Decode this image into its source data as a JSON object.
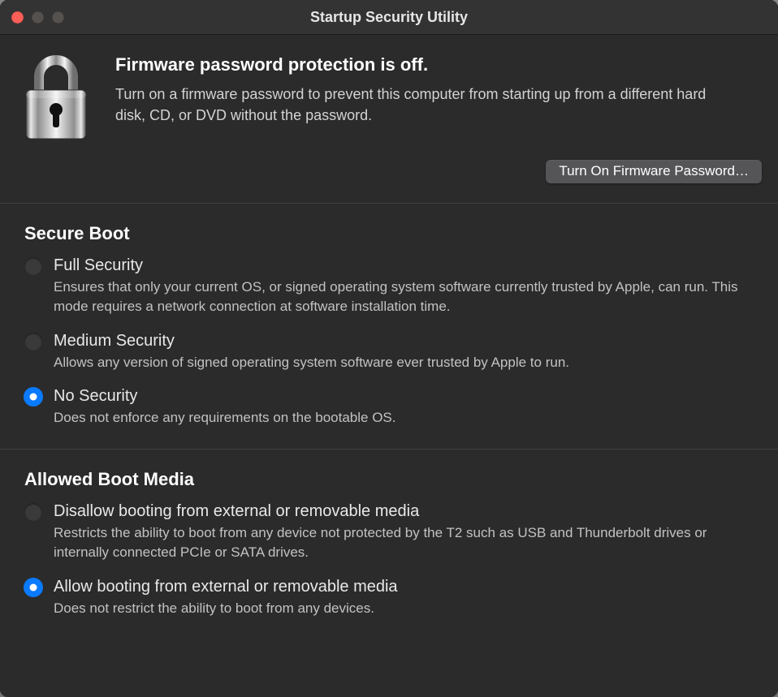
{
  "window": {
    "title": "Startup Security Utility"
  },
  "firmware": {
    "heading": "Firmware password protection is off.",
    "description": "Turn on a firmware password to prevent this computer from starting up from a different hard disk, CD, or DVD without the password.",
    "button_label": "Turn On Firmware Password…"
  },
  "secure_boot": {
    "title": "Secure Boot",
    "options": [
      {
        "label": "Full Security",
        "description": "Ensures that only your current OS, or signed operating system software currently trusted by Apple, can run. This mode requires a network connection at software installation time.",
        "selected": false
      },
      {
        "label": "Medium Security",
        "description": "Allows any version of signed operating system software ever trusted by Apple to run.",
        "selected": false
      },
      {
        "label": "No Security",
        "description": "Does not enforce any requirements on the bootable OS.",
        "selected": true
      }
    ]
  },
  "boot_media": {
    "title": "Allowed Boot Media",
    "options": [
      {
        "label": "Disallow booting from external or removable media",
        "description": "Restricts the ability to boot from any device not protected by the T2 such as USB and Thunderbolt drives or internally connected PCIe or SATA drives.",
        "selected": false
      },
      {
        "label": "Allow booting from external or removable media",
        "description": "Does not restrict the ability to boot from any devices.",
        "selected": true
      }
    ]
  }
}
